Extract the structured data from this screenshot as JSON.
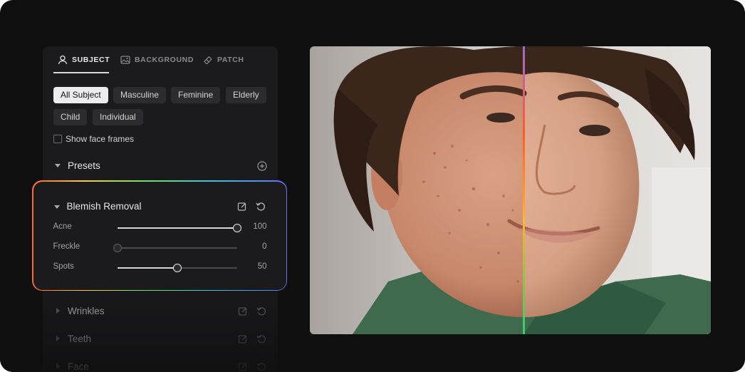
{
  "tabs": [
    {
      "label": "SUBJECT",
      "icon": "person-icon",
      "active": true
    },
    {
      "label": "BACKGROUND",
      "icon": "landscape-icon",
      "active": false
    },
    {
      "label": "PATCH",
      "icon": "eraser-icon",
      "active": false
    }
  ],
  "filters": [
    "All Subject",
    "Masculine",
    "Feminine",
    "Elderly",
    "Child",
    "Individual"
  ],
  "active_filter": "All Subject",
  "show_face_frames": {
    "label": "Show face frames",
    "checked": false
  },
  "presets": {
    "label": "Presets",
    "add_icon": "plus-circle-icon"
  },
  "blemish_removal": {
    "title": "Blemish Removal",
    "sliders": [
      {
        "label": "Acne",
        "value": "100",
        "fraction": 1.0
      },
      {
        "label": "Freckle",
        "value": "0",
        "fraction": 0.0
      },
      {
        "label": "Spots",
        "value": "50",
        "fraction": 0.5
      }
    ]
  },
  "collapsed_sections": [
    "Wrinkles",
    "Teeth",
    "Face"
  ],
  "colors": {
    "background": "#0f0f10",
    "panel": "#1b1b1d",
    "chip": "#2c2c30",
    "chip_active": "#ededf0",
    "split_line_top": "#9b6bd6",
    "split_line_mid": "#ff5a2b",
    "split_line_bottom": "#2fd06a"
  },
  "photo": {
    "description_icon": "before-after-portrait"
  }
}
